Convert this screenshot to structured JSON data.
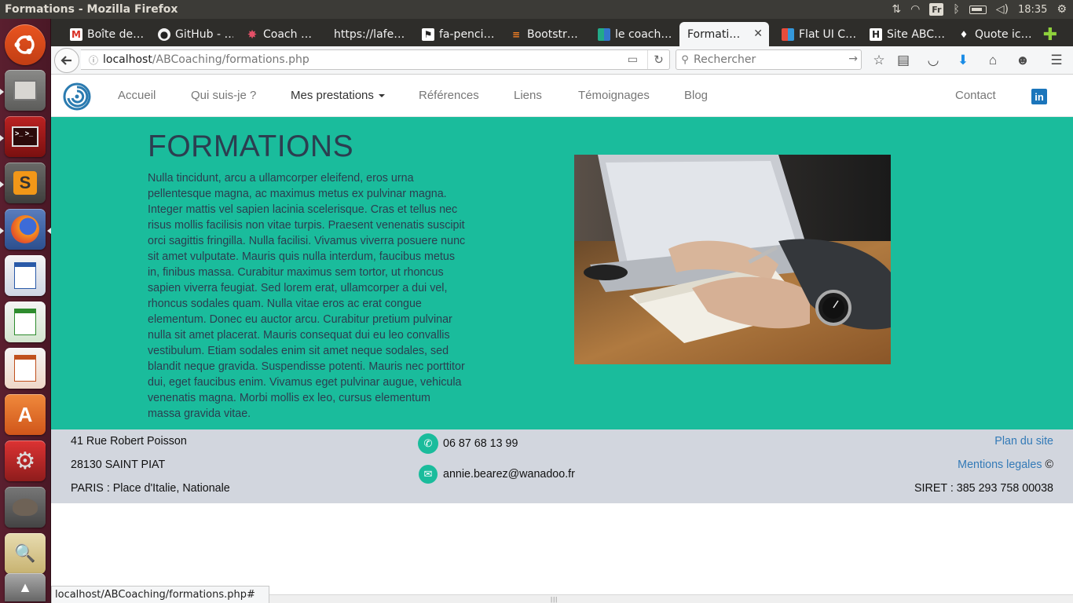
{
  "window": {
    "title": "Formations - Mozilla Firefox"
  },
  "system": {
    "keyboard": "Fr",
    "time": "18:35"
  },
  "tabs": [
    {
      "label": "Boîte de…",
      "icon": "gmail-icon"
    },
    {
      "label": "GitHub - …",
      "icon": "github-icon"
    },
    {
      "label": "Coach …",
      "icon": "star-icon"
    },
    {
      "label": "https://lafe…",
      "icon": ""
    },
    {
      "label": "fa-penci…",
      "icon": "flag-icon"
    },
    {
      "label": "Bootstr…",
      "icon": "stackoverflow-icon"
    },
    {
      "label": "le coach…",
      "icon": "bookmark-icon"
    },
    {
      "label": "Formati…",
      "icon": ""
    },
    {
      "label": "Flat UI C…",
      "icon": "grid-icon"
    },
    {
      "label": "Site ABC…",
      "icon": "h-icon"
    },
    {
      "label": "Quote ic…",
      "icon": "quote-icon"
    }
  ],
  "navbar": {
    "url_host": "localhost",
    "url_path": "/ABCoaching/formations.php",
    "search_placeholder": "Rechercher"
  },
  "site_nav": {
    "items": [
      "Accueil",
      "Qui suis-je ?",
      "Mes prestations",
      "Références",
      "Liens",
      "Témoignages",
      "Blog"
    ],
    "contact": "Contact",
    "linkedin": "in"
  },
  "hero": {
    "title": "FORMATIONS",
    "text": "Nulla tincidunt, arcu a ullamcorper eleifend, eros urna pellentesque magna, ac maximus metus ex pulvinar magna. Integer mattis vel sapien lacinia scelerisque. Cras et tellus nec risus mollis facilisis non vitae turpis. Praesent venenatis suscipit orci sagittis fringilla. Nulla facilisi. Vivamus viverra posuere nunc sit amet vulputate. Mauris quis nulla interdum, faucibus metus in, finibus massa. Curabitur maximus sem tortor, ut rhoncus sapien viverra feugiat. Sed lorem erat, ullamcorper a dui vel, rhoncus sodales quam. Nulla vitae eros ac erat congue elementum. Donec eu auctor arcu. Curabitur pretium pulvinar nulla sit amet placerat. Mauris consequat dui eu leo convallis vestibulum. Etiam sodales enim sit amet neque sodales, sed blandit neque gravida. Suspendisse potenti. Mauris nec porttitor dui, eget faucibus enim. Vivamus eget pulvinar augue, vehicula venenatis magna. Morbi mollis ex leo, cursus elementum massa gravida vitae."
  },
  "footer": {
    "address1": "41 Rue Robert Poisson",
    "address2": "28130 SAINT PIAT",
    "address3": "PARIS : Place d'Italie, Nationale",
    "phone": "06 87 68 13 99",
    "email": "annie.bearez@wanadoo.fr",
    "sitemap": "Plan du site",
    "legal": "Mentions legales",
    "copyright": "©",
    "siret": "SIRET : 385 293 758 00038"
  },
  "statusbar": {
    "text": "localhost/ABCoaching/formations.php#"
  },
  "colors": {
    "accent": "#1abc9c",
    "footer_bg": "#d2d6de",
    "heading": "#2c3e50",
    "link": "#337ab7",
    "launcher": "#5a1f2f"
  }
}
